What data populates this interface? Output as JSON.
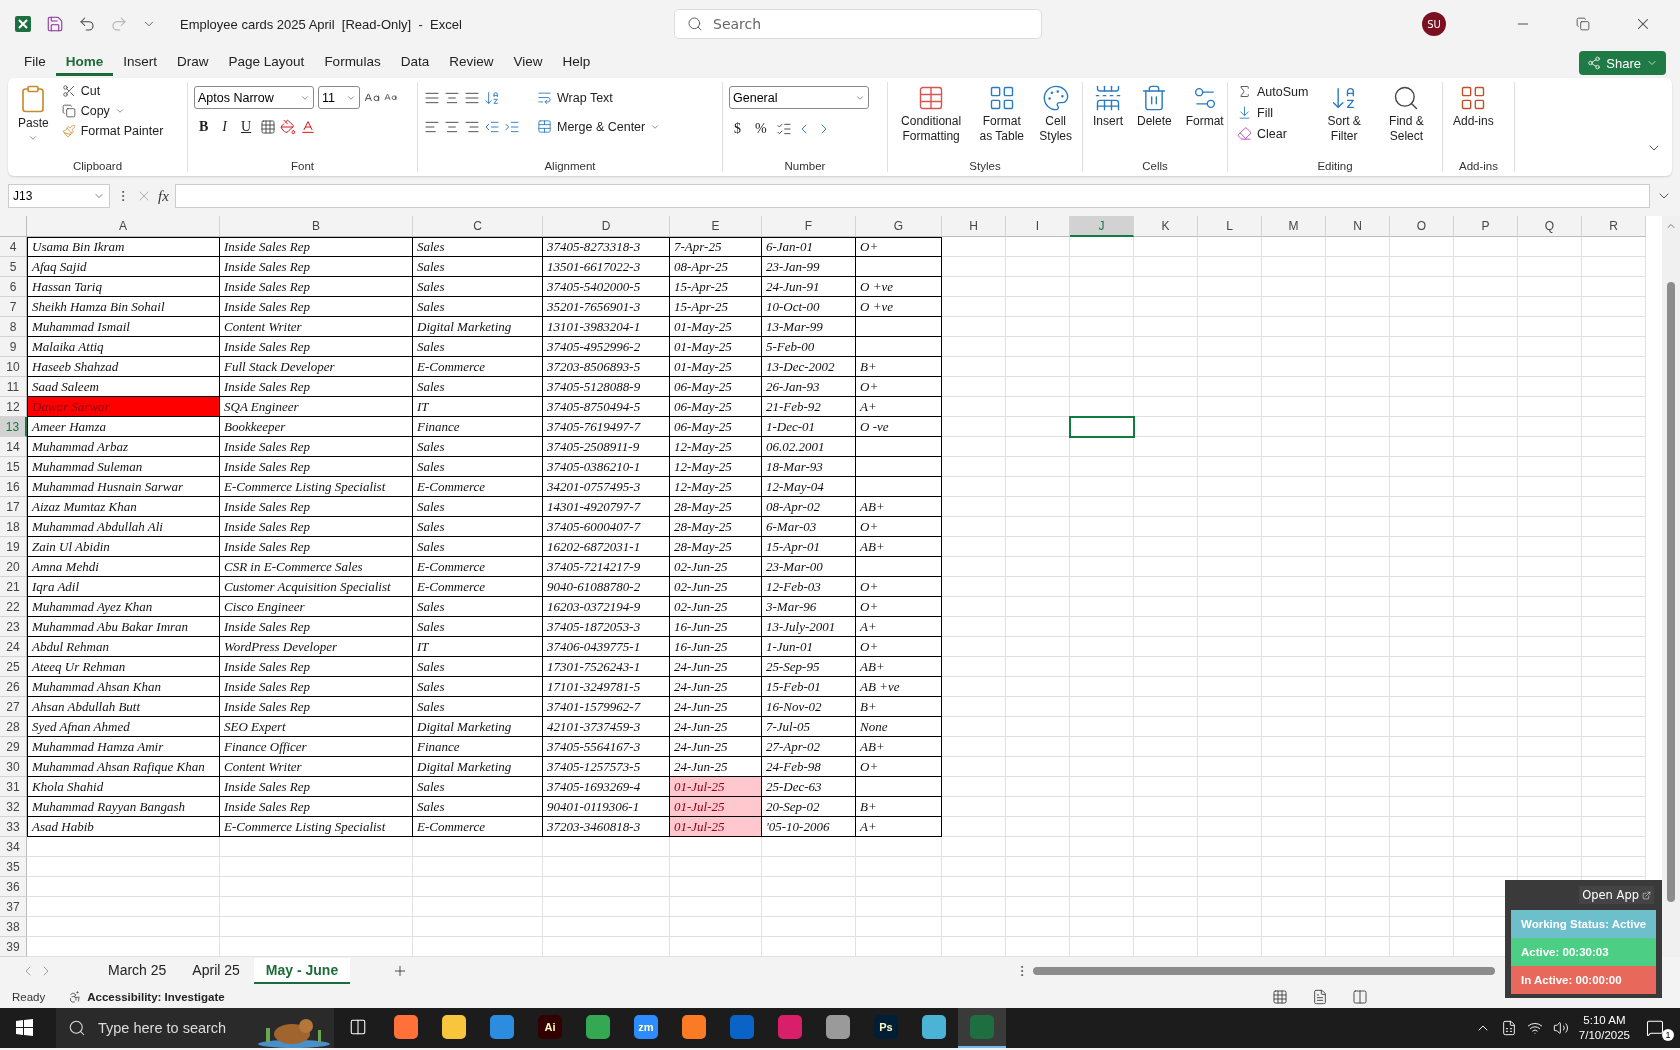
{
  "window": {
    "title": "Employee cards 2025 April  [Read-Only]  -  Excel",
    "search_placeholder": "Search",
    "avatar": "SU"
  },
  "menu_tabs": [
    {
      "label": "File",
      "selected": false
    },
    {
      "label": "Home",
      "selected": true
    },
    {
      "label": "Insert",
      "selected": false
    },
    {
      "label": "Draw",
      "selected": false
    },
    {
      "label": "Page Layout",
      "selected": false
    },
    {
      "label": "Formulas",
      "selected": false
    },
    {
      "label": "Data",
      "selected": false
    },
    {
      "label": "Review",
      "selected": false
    },
    {
      "label": "View",
      "selected": false
    },
    {
      "label": "Help",
      "selected": false
    }
  ],
  "share": "Share",
  "ribbon": {
    "clipboard": {
      "label": "Clipboard",
      "paste": "Paste",
      "cut": "Cut",
      "copy": "Copy",
      "format_painter": "Format Painter"
    },
    "font": {
      "label": "Font",
      "font_name": "Aptos Narrow",
      "font_size": "11",
      "bold": "B",
      "italic": "I",
      "underline": "U"
    },
    "alignment": {
      "label": "Alignment",
      "wrap_text": "Wrap Text",
      "merge": "Merge & Center"
    },
    "number": {
      "label": "Number",
      "format": "General",
      "currency": "$",
      "percent": "%"
    },
    "styles": {
      "label": "Styles",
      "buttons": [
        "Conditional Formatting",
        "Format as Table",
        "Cell Styles"
      ]
    },
    "cells": {
      "label": "Cells",
      "buttons": [
        "Insert",
        "Delete",
        "Format"
      ]
    },
    "editing": {
      "label": "Editing",
      "autosum": "AutoSum",
      "fill": "Fill",
      "clear": "Clear",
      "sort": "Sort & Filter",
      "find": "Find & Select"
    },
    "addins": {
      "label": "Add-ins",
      "button": "Add-ins"
    }
  },
  "formula_bar": {
    "name_box": "J13",
    "fx": "fx"
  },
  "columns": [
    {
      "label": "A",
      "selected": false
    },
    {
      "label": "B",
      "selected": false
    },
    {
      "label": "C",
      "selected": false
    },
    {
      "label": "D",
      "selected": false
    },
    {
      "label": "E",
      "selected": false
    },
    {
      "label": "F",
      "selected": false
    },
    {
      "label": "G",
      "selected": false
    },
    {
      "label": "H",
      "selected": false
    },
    {
      "label": "I",
      "selected": false
    },
    {
      "label": "J",
      "selected": true
    },
    {
      "label": "K",
      "selected": false
    },
    {
      "label": "L",
      "selected": false
    },
    {
      "label": "M",
      "selected": false
    },
    {
      "label": "N",
      "selected": false
    },
    {
      "label": "O",
      "selected": false
    },
    {
      "label": "P",
      "selected": false
    },
    {
      "label": "Q",
      "selected": false
    },
    {
      "label": "R",
      "selected": false
    }
  ],
  "rows": [
    {
      "number": "4",
      "selected": false,
      "cells": [
        "Usama Bin Ikram",
        "Inside Sales Rep",
        "Sales",
        "37405-8273318-3",
        "7-Apr-25",
        "6-Jan-01",
        "O+"
      ]
    },
    {
      "number": "5",
      "selected": false,
      "cells": [
        "Afaq Sajid",
        "Inside Sales Rep",
        "Sales",
        "13501-6617022-3",
        "08-Apr-25",
        "23-Jan-99",
        null
      ]
    },
    {
      "number": "6",
      "selected": false,
      "cells": [
        "Hassan Tariq",
        "Inside Sales Rep",
        "Sales",
        "37405-5402000-5",
        "15-Apr-25",
        "24-Jun-91",
        "O +ve"
      ]
    },
    {
      "number": "7",
      "selected": false,
      "cells": [
        "Sheikh Hamza Bin Sohail",
        "Inside Sales Rep",
        "Sales",
        "35201-7656901-3",
        "15-Apr-25",
        "10-Oct-00",
        "O +ve"
      ]
    },
    {
      "number": "8",
      "selected": false,
      "cells": [
        "Muhammad Ismail",
        "Content Writer",
        "Digital Marketing",
        "13101-3983204-1",
        "01-May-25",
        "13-Mar-99",
        null
      ]
    },
    {
      "number": "9",
      "selected": false,
      "cells": [
        "Malaika Attiq",
        "Inside Sales Rep",
        "Sales",
        "37405-4952996-2",
        "01-May-25",
        "5-Feb-00",
        null
      ]
    },
    {
      "number": "10",
      "selected": false,
      "cells": [
        "Haseeb Shahzad",
        "Full Stack Developer",
        "E-Commerce",
        "37203-8506893-5",
        "01-May-25",
        "13-Dec-2002",
        "B+"
      ]
    },
    {
      "number": "11",
      "selected": false,
      "cells": [
        "Saad Saleem",
        "Inside Sales Rep",
        "Sales",
        "37405-5128088-9",
        "06-May-25",
        "26-Jan-93",
        "O+"
      ]
    },
    {
      "number": "12",
      "selected": false,
      "cells": [
        {
          "text": "Dawar Sarwar",
          "color": "#ff0000"
        },
        "SQA Engineer",
        "IT",
        "37405-8750494-5",
        "06-May-25",
        "21-Feb-92",
        "A+"
      ]
    },
    {
      "number": "13",
      "selected": true,
      "cells": [
        "Ameer Hamza",
        "Bookkeeper",
        "Finance",
        "37405-7619497-7",
        "06-May-25",
        "1-Dec-01",
        "O -ve"
      ]
    },
    {
      "number": "14",
      "selected": false,
      "cells": [
        "Muhammad Arbaz",
        "Inside Sales Rep",
        "Sales",
        "37405-2508911-9",
        "12-May-25",
        "06.02.2001",
        null
      ]
    },
    {
      "number": "15",
      "selected": false,
      "cells": [
        "Muhammad Suleman",
        "Inside Sales Rep",
        "Sales",
        "37405-0386210-1",
        "12-May-25",
        "18-Mar-93",
        null
      ]
    },
    {
      "number": "16",
      "selected": false,
      "cells": [
        "Muhammad Husnain Sarwar",
        "E-Commerce Listing Specialist",
        "E-Commerce",
        "34201-0757495-3",
        "12-May-25",
        "12-May-04",
        null
      ]
    },
    {
      "number": "17",
      "selected": false,
      "cells": [
        "Aizaz Mumtaz Khan",
        "Inside Sales Rep",
        "Sales",
        "14301-4920797-7",
        "28-May-25",
        "08-Apr-02",
        "AB+"
      ]
    },
    {
      "number": "18",
      "selected": false,
      "cells": [
        "Muhammad Abdullah Ali",
        "Inside Sales Rep",
        "Sales",
        "37405-6000407-7",
        "28-May-25",
        "6-Mar-03",
        "O+"
      ]
    },
    {
      "number": "19",
      "selected": false,
      "cells": [
        "Zain Ul Abidin",
        "Inside Sales Rep",
        "Sales",
        "16202-6872031-1",
        "28-May-25",
        "15-Apr-01",
        "AB+"
      ]
    },
    {
      "number": "20",
      "selected": false,
      "cells": [
        "Amna Mehdi",
        "CSR in E-Commerce Sales",
        "E-Commerce",
        "37405-7214217-9",
        "02-Jun-25",
        "23-Mar-00",
        null
      ]
    },
    {
      "number": "21",
      "selected": false,
      "cells": [
        "Iqra Adil",
        "Customer Acquisition Specialist",
        "E-Commerce",
        "9040-61088780-2",
        "02-Jun-25",
        "12-Feb-03",
        "O+"
      ]
    },
    {
      "number": "22",
      "selected": false,
      "cells": [
        "Muhammad Ayez Khan",
        "Cisco Engineer",
        "Sales",
        "16203-0372194-9",
        "02-Jun-25",
        "3-Mar-96",
        "O+"
      ]
    },
    {
      "number": "23",
      "selected": false,
      "cells": [
        "Muhammad Abu Bakar Imran",
        "Inside Sales Rep",
        "Sales",
        "37405-1872053-3",
        "16-Jun-25",
        "13-July-2001",
        "A+"
      ]
    },
    {
      "number": "24",
      "selected": false,
      "cells": [
        "Abdul Rehman",
        "WordPress Developer",
        "IT",
        "37406-0439775-1",
        "16-Jun-25",
        "1-Jun-01",
        "O+"
      ]
    },
    {
      "number": "25",
      "selected": false,
      "cells": [
        "Ateeq Ur Rehman",
        "Inside Sales Rep",
        "Sales",
        "17301-7526243-1",
        "24-Jun-25",
        "25-Sep-95",
        "AB+"
      ]
    },
    {
      "number": "26",
      "selected": false,
      "cells": [
        "Muhammad Ahsan Khan",
        "Inside Sales Rep",
        "Sales",
        "17101-3249781-5",
        "24-Jun-25",
        "15-Feb-01",
        "AB +ve"
      ]
    },
    {
      "number": "27",
      "selected": false,
      "cells": [
        "Ahsan Abdullah Butt",
        "Inside Sales Rep",
        "Sales",
        "37401-1579962-7",
        "24-Jun-25",
        "16-Nov-02",
        "B+"
      ]
    },
    {
      "number": "28",
      "selected": false,
      "cells": [
        "Syed Afnan Ahmed",
        "SEO Expert",
        "Digital Marketing",
        "42101-3737459-3",
        "24-Jun-25",
        "7-Jul-05",
        "None"
      ]
    },
    {
      "number": "29",
      "selected": false,
      "cells": [
        "Muhammad Hamza Amir",
        "Finance Officer",
        "Finance",
        "37405-5564167-3",
        "24-Jun-25",
        "27-Apr-02",
        "AB+"
      ]
    },
    {
      "number": "30",
      "selected": false,
      "cells": [
        "Muhammad Ahsan Rafique Khan",
        "Content Writer",
        "Digital Marketing",
        "37405-1257573-5",
        "24-Jun-25",
        "24-Feb-98",
        "O+"
      ]
    },
    {
      "number": "31",
      "selected": false,
      "cells": [
        "Khola Shahid",
        "Inside Sales Rep",
        "Sales",
        "37405-1693269-4",
        {
          "text": "01-Jul-25",
          "color": "#ffc7ce"
        },
        "25-Dec-63",
        null
      ]
    },
    {
      "number": "32",
      "selected": false,
      "cells": [
        "Muhammad Rayyan Bangash",
        "Inside Sales Rep",
        "Sales",
        "90401-0119306-1",
        {
          "text": "01-Jul-25",
          "color": "#ffc7ce"
        },
        "20-Sep-02",
        "B+"
      ]
    },
    {
      "number": "33",
      "selected": false,
      "cells": [
        "Asad Habib",
        "E-Commerce Listing Specialist",
        "E-Commerce",
        "37203-3460818-3",
        {
          "text": "01-Jul-25",
          "color": "#ffc7ce"
        },
        "'05-10-2006",
        "A+"
      ]
    },
    {
      "number": "34",
      "selected": false
    },
    {
      "number": "35",
      "selected": false
    },
    {
      "number": "36",
      "selected": false
    },
    {
      "number": "37",
      "selected": false
    },
    {
      "number": "38",
      "selected": false
    },
    {
      "number": "39",
      "selected": false
    }
  ],
  "sheet_tabs": [
    {
      "label": "March 25",
      "selected": false
    },
    {
      "label": "April 25",
      "selected": false
    },
    {
      "label": "May - June",
      "selected": true
    }
  ],
  "status_bar": {
    "ready": "Ready",
    "accessibility": "Accessibility: Investigate"
  },
  "widget": {
    "open_app": "Open App",
    "status": "Working Status: Active",
    "active": "Active: 00:30:03",
    "inactive": "In Active: 00:00:00"
  },
  "taskbar": {
    "search_placeholder": "Type here to search",
    "time": "5:10 AM",
    "date": "7/10/2025",
    "notifications": "1",
    "apps": [
      {
        "kind": "tasks"
      },
      {
        "kind": "app",
        "color": "#ff7139"
      },
      {
        "kind": "app",
        "color": "#f8c63d"
      },
      {
        "kind": "app",
        "color": "#2b8ce0"
      },
      {
        "kind": "app",
        "color": "#330000",
        "label": "Ai"
      },
      {
        "kind": "app",
        "color": "#34a853"
      },
      {
        "kind": "app",
        "color": "#2d8cff",
        "label": "zm"
      },
      {
        "kind": "app",
        "color": "#fb7a24"
      },
      {
        "kind": "app",
        "color": "#0a64c8"
      },
      {
        "kind": "app",
        "color": "#da1f6a"
      },
      {
        "kind": "app",
        "color": "#9a9a9a"
      },
      {
        "kind": "app",
        "color": "#001e36",
        "label": "Ps"
      },
      {
        "kind": "app",
        "color": "#4ab3d6"
      },
      {
        "kind": "app",
        "color": "#1d6f42",
        "active": true
      }
    ]
  }
}
